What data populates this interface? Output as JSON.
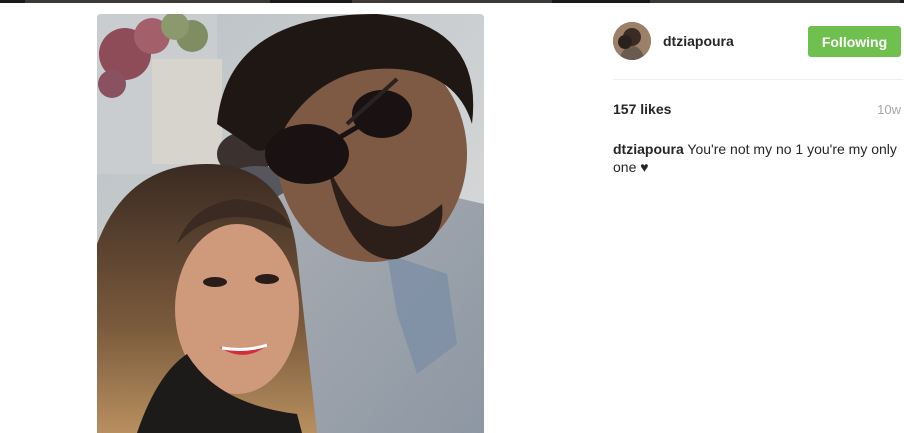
{
  "post": {
    "photo_icon": "photo-image",
    "author": {
      "username": "dtziapoura",
      "avatar_icon": "avatar-image"
    },
    "follow_button_label": "Following",
    "follow_button_color": "#70c050",
    "likes_text": "157 likes",
    "time_ago": "10w",
    "caption": {
      "username": "dtziapoura",
      "text": "You're not my no 1 you're my only one",
      "heart_glyph": "♥"
    }
  },
  "colors": {
    "text": "#262626",
    "muted": "#a5a7aa",
    "divider": "#efefef"
  }
}
